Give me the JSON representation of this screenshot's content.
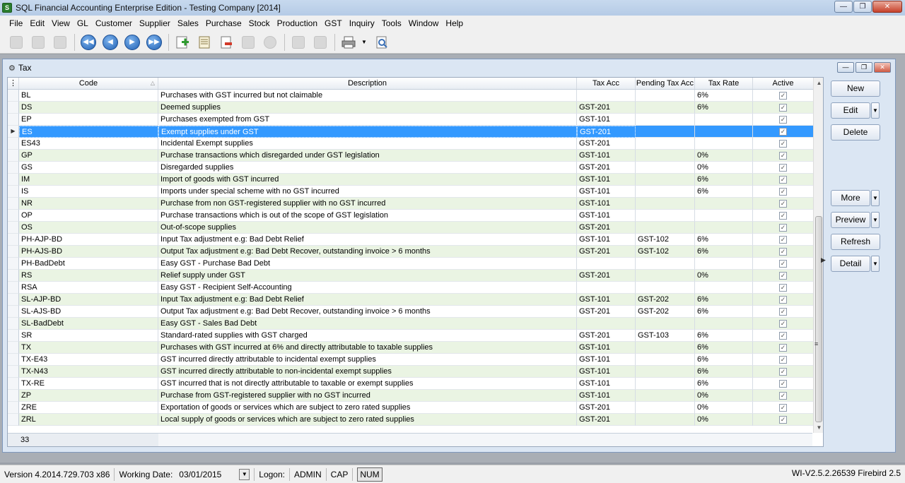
{
  "window": {
    "title": "SQL Financial Accounting Enterprise Edition - Testing Company [2014]",
    "min_icon": "minimize-icon",
    "max_icon": "restore-icon",
    "close_icon": "close-icon"
  },
  "menu": [
    "File",
    "Edit",
    "View",
    "GL",
    "Customer",
    "Supplier",
    "Sales",
    "Purchase",
    "Stock",
    "Production",
    "GST",
    "Inquiry",
    "Tools",
    "Window",
    "Help"
  ],
  "child": {
    "title": "Tax"
  },
  "grid": {
    "columns": {
      "code": "Code",
      "description": "Description",
      "tax_acc": "Tax Acc",
      "pending_tax_acc": "Pending Tax Acc",
      "tax_rate": "Tax Rate",
      "active": "Active"
    },
    "rows": [
      {
        "code": "BL",
        "description": "Purchases with GST incurred but not claimable",
        "tax_acc": "",
        "pending": "",
        "rate": "6%"
      },
      {
        "code": "DS",
        "description": "Deemed supplies",
        "tax_acc": "GST-201",
        "pending": "",
        "rate": "6%"
      },
      {
        "code": "EP",
        "description": "Purchases exempted from GST",
        "tax_acc": "GST-101",
        "pending": "",
        "rate": ""
      },
      {
        "code": "ES",
        "description": "Exempt supplies under GST",
        "tax_acc": "GST-201",
        "pending": "",
        "rate": ""
      },
      {
        "code": "ES43",
        "description": "Incidental Exempt supplies",
        "tax_acc": "GST-201",
        "pending": "",
        "rate": ""
      },
      {
        "code": "GP",
        "description": "Purchase transactions which disregarded under GST legislation",
        "tax_acc": "GST-101",
        "pending": "",
        "rate": "0%"
      },
      {
        "code": "GS",
        "description": "Disregarded supplies",
        "tax_acc": "GST-201",
        "pending": "",
        "rate": "0%"
      },
      {
        "code": "IM",
        "description": "Import of goods with GST incurred",
        "tax_acc": "GST-101",
        "pending": "",
        "rate": "6%"
      },
      {
        "code": "IS",
        "description": "Imports under special scheme with no GST incurred",
        "tax_acc": "GST-101",
        "pending": "",
        "rate": "6%"
      },
      {
        "code": "NR",
        "description": "Purchase from non GST-registered supplier with no GST incurred",
        "tax_acc": "GST-101",
        "pending": "",
        "rate": ""
      },
      {
        "code": "OP",
        "description": "Purchase transactions which is out of the scope of GST legislation",
        "tax_acc": "GST-101",
        "pending": "",
        "rate": ""
      },
      {
        "code": "OS",
        "description": "Out-of-scope supplies",
        "tax_acc": "GST-201",
        "pending": "",
        "rate": ""
      },
      {
        "code": "PH-AJP-BD",
        "description": "Input Tax adjustment e.g: Bad Debt Relief",
        "tax_acc": "GST-101",
        "pending": "GST-102",
        "rate": "6%"
      },
      {
        "code": "PH-AJS-BD",
        "description": "Output Tax adjustment e.g: Bad Debt Recover, outstanding invoice > 6 months",
        "tax_acc": "GST-201",
        "pending": "GST-102",
        "rate": "6%"
      },
      {
        "code": "PH-BadDebt",
        "description": "Easy GST - Purchase Bad Debt",
        "tax_acc": "",
        "pending": "",
        "rate": ""
      },
      {
        "code": "RS",
        "description": "Relief supply under GST",
        "tax_acc": "GST-201",
        "pending": "",
        "rate": "0%"
      },
      {
        "code": "RSA",
        "description": "Easy GST - Recipient Self-Accounting",
        "tax_acc": "",
        "pending": "",
        "rate": ""
      },
      {
        "code": "SL-AJP-BD",
        "description": "Input Tax adjustment e.g: Bad Debt Relief",
        "tax_acc": "GST-101",
        "pending": "GST-202",
        "rate": "6%"
      },
      {
        "code": "SL-AJS-BD",
        "description": "Output Tax adjustment e.g: Bad Debt Recover, outstanding invoice > 6 months",
        "tax_acc": "GST-201",
        "pending": "GST-202",
        "rate": "6%"
      },
      {
        "code": "SL-BadDebt",
        "description": "Easy GST - Sales Bad Debt",
        "tax_acc": "",
        "pending": "",
        "rate": ""
      },
      {
        "code": "SR",
        "description": "Standard-rated supplies with GST charged",
        "tax_acc": "GST-201",
        "pending": "GST-103",
        "rate": "6%"
      },
      {
        "code": "TX",
        "description": "Purchases with GST incurred at 6% and directly attributable to taxable supplies",
        "tax_acc": "GST-101",
        "pending": "",
        "rate": "6%"
      },
      {
        "code": "TX-E43",
        "description": "GST incurred directly attributable to incidental exempt supplies",
        "tax_acc": "GST-101",
        "pending": "",
        "rate": "6%"
      },
      {
        "code": "TX-N43",
        "description": "GST incurred directly attributable to non-incidental exempt supplies",
        "tax_acc": "GST-101",
        "pending": "",
        "rate": "6%"
      },
      {
        "code": "TX-RE",
        "description": "GST incurred that is not directly attributable to taxable or exempt supplies",
        "tax_acc": "GST-101",
        "pending": "",
        "rate": "6%"
      },
      {
        "code": "ZP",
        "description": "Purchase from GST-registered supplier with no GST incurred",
        "tax_acc": "GST-101",
        "pending": "",
        "rate": "0%"
      },
      {
        "code": "ZRE",
        "description": "Exportation of goods or services which are subject to zero rated supplies",
        "tax_acc": "GST-201",
        "pending": "",
        "rate": "0%"
      },
      {
        "code": "ZRL",
        "description": "Local supply of goods or services which are subject to zero rated supplies",
        "tax_acc": "GST-201",
        "pending": "",
        "rate": "0%"
      }
    ],
    "selected_index": 3,
    "record_count": "33"
  },
  "buttons": {
    "new": "New",
    "edit": "Edit",
    "delete": "Delete",
    "more": "More",
    "preview": "Preview",
    "refresh": "Refresh",
    "detail": "Detail"
  },
  "status": {
    "version": "Version 4.2014.729.703 x86",
    "working_date_label": "Working Date:",
    "working_date": "03/01/2015",
    "logon_label": "Logon:",
    "user": "ADMIN",
    "cap": "CAP",
    "num": "NUM",
    "db_info": "WI-V2.5.2.26539 Firebird 2.5"
  },
  "colors": {
    "selection": "#3399ff",
    "alt_row": "#eaf4e3"
  }
}
